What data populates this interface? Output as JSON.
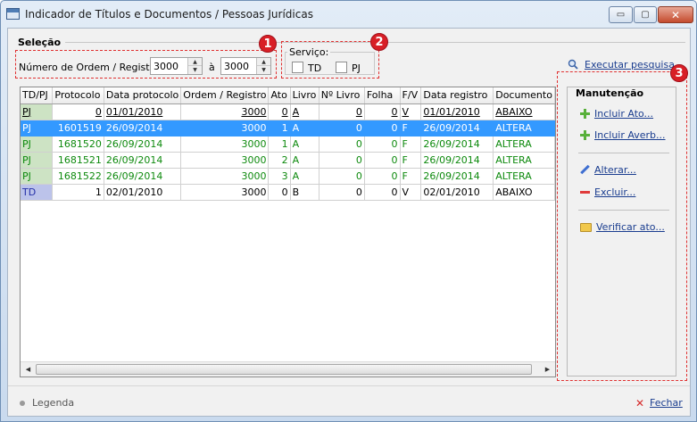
{
  "window": {
    "title": "Indicador de Títulos e Documentos / Pessoas Jurídicas",
    "controls": {
      "minimize": "▭",
      "maximize": "▢",
      "close": "✕"
    }
  },
  "selecao": {
    "title": "Seleção",
    "ordem_label": "Número de Ordem / Registro:",
    "ordem_from": "3000",
    "between": "à",
    "ordem_to": "3000"
  },
  "servico": {
    "title": "Serviço:",
    "td_label": "TD",
    "pj_label": "PJ"
  },
  "badges": [
    "1",
    "2",
    "3"
  ],
  "executar_label": "Executar pesquisa",
  "grid": {
    "columns": [
      "TD/PJ",
      "Protocolo",
      "Data protocolo",
      "Ordem / Registro",
      "Ato",
      "Livro",
      "Nº Livro",
      "Folha",
      "F/V",
      "Data registro",
      "Documento"
    ],
    "rows": [
      {
        "style": "u",
        "cells": [
          "PJ",
          "0",
          "01/01/2010",
          "3000",
          "0",
          "A",
          "0",
          "0",
          "V",
          "01/01/2010",
          "ABAIXO"
        ]
      },
      {
        "style": "sel",
        "cells": [
          "PJ",
          "1601519",
          "26/09/2014",
          "3000",
          "1",
          "A",
          "0",
          "0",
          "F",
          "26/09/2014",
          "ALTERA"
        ]
      },
      {
        "style": "g",
        "cells": [
          "PJ",
          "1681520",
          "26/09/2014",
          "3000",
          "1",
          "A",
          "0",
          "0",
          "F",
          "26/09/2014",
          "ALTERA"
        ]
      },
      {
        "style": "g",
        "cells": [
          "PJ",
          "1681521",
          "26/09/2014",
          "3000",
          "2",
          "A",
          "0",
          "0",
          "F",
          "26/09/2014",
          "ALTERA"
        ]
      },
      {
        "style": "g",
        "cells": [
          "PJ",
          "1681522",
          "26/09/2014",
          "3000",
          "3",
          "A",
          "0",
          "0",
          "F",
          "26/09/2014",
          "ALTERA"
        ]
      },
      {
        "style": "td",
        "cells": [
          "TD",
          "1",
          "02/01/2010",
          "3000",
          "0",
          "B",
          "0",
          "0",
          "V",
          "02/01/2010",
          "ABAIXO"
        ]
      }
    ]
  },
  "manutencao": {
    "title": "Manutenção",
    "incluir_ato": "Incluir Ato...",
    "incluir_averb": "Incluir Averb...",
    "alterar": "Alterar...",
    "excluir": "Excluir...",
    "verificar": "Verificar ato..."
  },
  "footer": {
    "legenda": "Legenda",
    "fechar": "Fechar"
  }
}
